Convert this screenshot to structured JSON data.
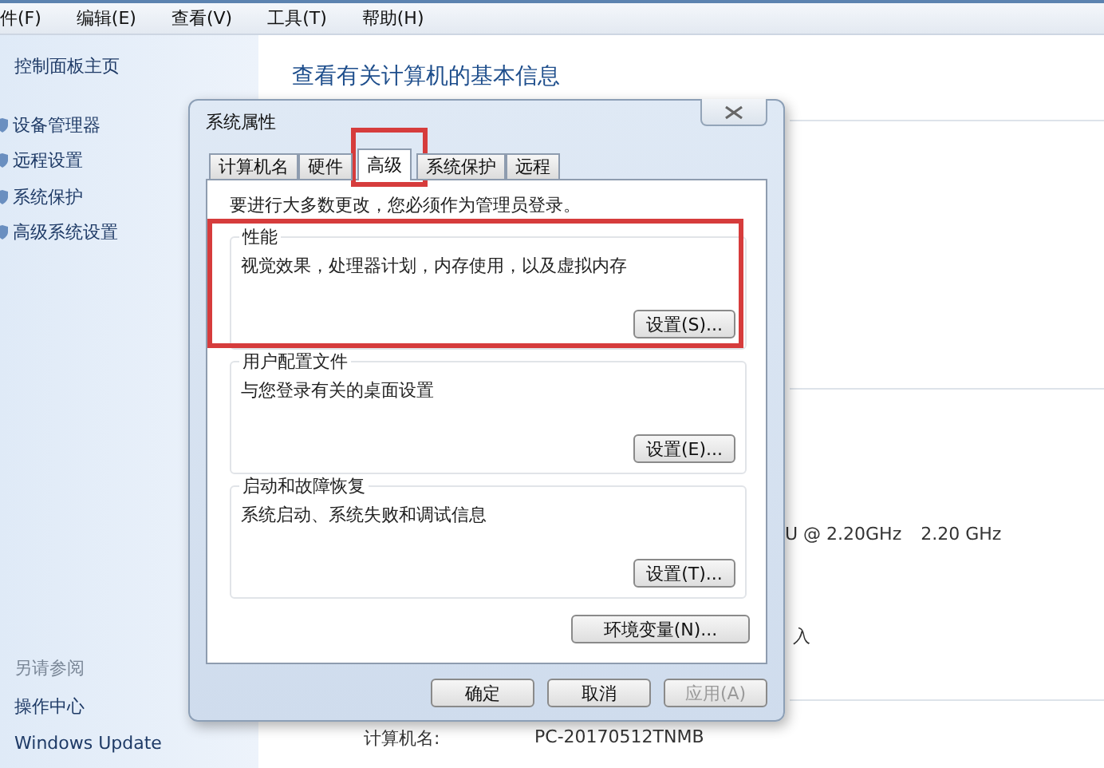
{
  "menu": [
    {
      "label": "件(F)"
    },
    {
      "label": "编辑(E)"
    },
    {
      "label": "查看(V)"
    },
    {
      "label": "工具(T)"
    },
    {
      "label": "帮助(H)"
    }
  ],
  "sidebar": {
    "home": "控制面板主页",
    "items": [
      {
        "label": "设备管理器"
      },
      {
        "label": "远程设置"
      },
      {
        "label": "系统保护"
      },
      {
        "label": "高级系统设置"
      }
    ],
    "see_also": {
      "title": "另请参阅",
      "items": [
        "操作中心",
        "Windows Update"
      ]
    }
  },
  "main": {
    "title": "查看有关计算机的基本信息",
    "processor": "U @ 2.20GHz",
    "speed": "2.20 GHz",
    "fragment": "入",
    "computer_name_label": "计算机名:",
    "computer_name": "PC-20170512TNMB"
  },
  "dialog": {
    "title": "系统属性",
    "tabs": [
      {
        "label": "计算机名",
        "selected": false
      },
      {
        "label": "硬件",
        "selected": false
      },
      {
        "label": "高级",
        "selected": true
      },
      {
        "label": "系统保护",
        "selected": false
      },
      {
        "label": "远程",
        "selected": false
      }
    ],
    "notice": "要进行大多数更改，您必须作为管理员登录。",
    "groups": [
      {
        "title": "性能",
        "description": "视觉效果，处理器计划，内存使用，以及虚拟内存",
        "button": "设置(S)..."
      },
      {
        "title": "用户配置文件",
        "description": "与您登录有关的桌面设置",
        "button": "设置(E)..."
      },
      {
        "title": "启动和故障恢复",
        "description": "系统启动、系统失败和调试信息",
        "button": "设置(T)..."
      }
    ],
    "env_button": "环境变量(N)...",
    "buttons": [
      {
        "label": "确定",
        "disabled": false
      },
      {
        "label": "取消",
        "disabled": false
      },
      {
        "label": "应用(A)",
        "disabled": true
      }
    ]
  }
}
